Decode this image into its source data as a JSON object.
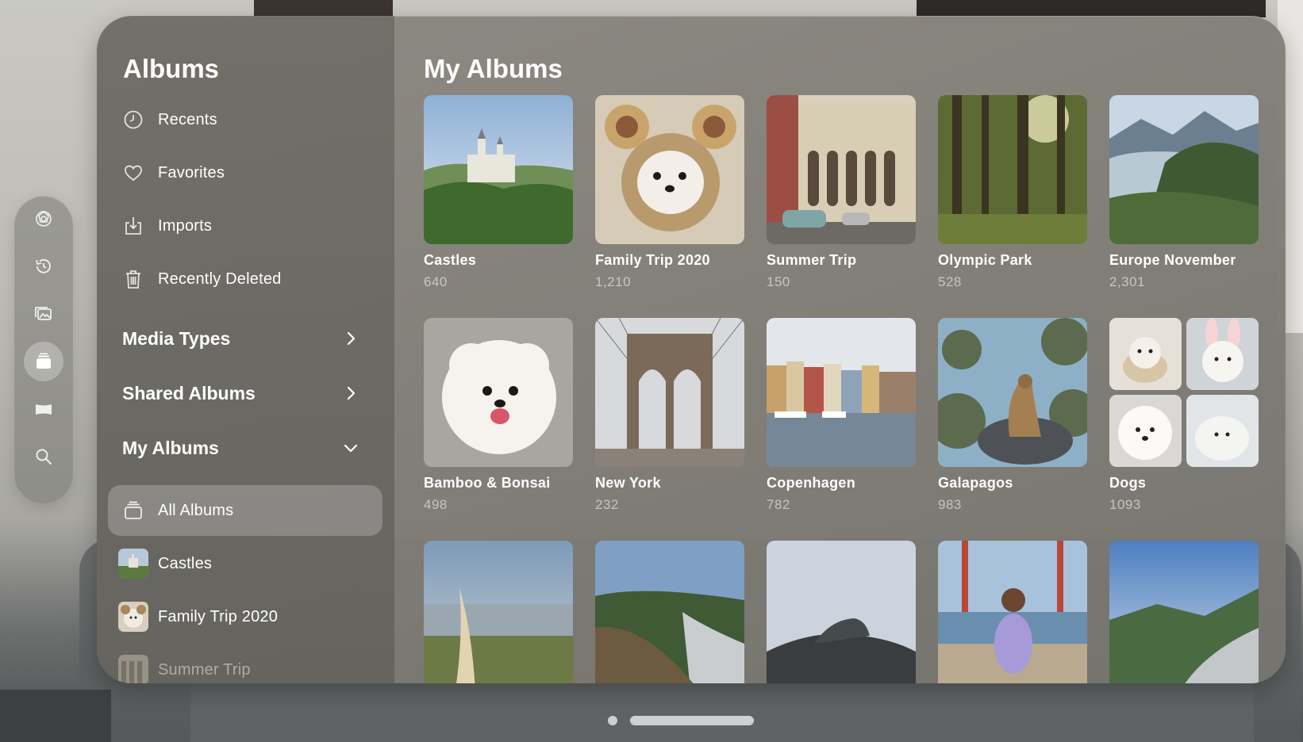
{
  "sidebar": {
    "title": "Albums",
    "items": [
      {
        "label": "Recents",
        "icon": "clock-icon"
      },
      {
        "label": "Favorites",
        "icon": "heart-icon"
      },
      {
        "label": "Imports",
        "icon": "import-icon"
      },
      {
        "label": "Recently Deleted",
        "icon": "trash-icon"
      }
    ],
    "sections": [
      {
        "label": "Media Types",
        "state": "collapsed"
      },
      {
        "label": "Shared Albums",
        "state": "collapsed"
      },
      {
        "label": "My Albums",
        "state": "expanded"
      }
    ],
    "my_albums": [
      {
        "label": "All Albums",
        "icon": "albums-stack-icon",
        "selected": true
      },
      {
        "label": "Castles"
      },
      {
        "label": "Family Trip 2020"
      },
      {
        "label": "Summer Trip"
      }
    ]
  },
  "ornament": {
    "tabs": [
      "apps-icon",
      "recent-activity-icon",
      "library-icon",
      "albums-icon",
      "panorama-icon",
      "search-icon"
    ],
    "active": "albums-icon"
  },
  "main": {
    "title": "My Albums",
    "albums": [
      {
        "name": "Castles",
        "count": "640"
      },
      {
        "name": "Family Trip 2020",
        "count": "1,210"
      },
      {
        "name": "Summer Trip",
        "count": "150"
      },
      {
        "name": "Olympic Park",
        "count": "528"
      },
      {
        "name": "Europe November",
        "count": "2,301"
      },
      {
        "name": "Bamboo & Bonsai",
        "count": "498"
      },
      {
        "name": "New York",
        "count": "232"
      },
      {
        "name": "Copenhagen",
        "count": "782"
      },
      {
        "name": "Galapagos",
        "count": "983"
      },
      {
        "name": "Dogs",
        "count": "1093"
      }
    ]
  }
}
